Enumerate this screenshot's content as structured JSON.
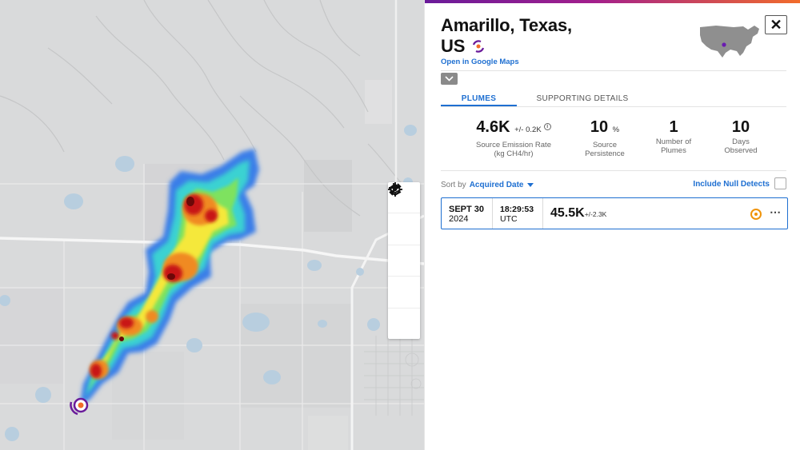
{
  "location": {
    "title_line1": "Amarillo, Texas,",
    "title_line2": "US",
    "maps_link": "Open in Google Maps"
  },
  "tabs": [
    {
      "label": "PLUMES",
      "active": true
    },
    {
      "label": "SUPPORTING DETAILS",
      "active": false
    }
  ],
  "stats": {
    "emission_rate": {
      "value": "4.6K",
      "uncertainty": "+/- 0.2K",
      "label_line1": "Source Emission Rate",
      "label_line2": "(kg CH4/hr)"
    },
    "persistence": {
      "value": "10",
      "unit": "%",
      "label_line1": "Source",
      "label_line2": "Persistence"
    },
    "plumes": {
      "value": "1",
      "label_line1": "Number of",
      "label_line2": "Plumes"
    },
    "days": {
      "value": "10",
      "label_line1": "Days",
      "label_line2": "Observed"
    }
  },
  "sort": {
    "prefix": "Sort by",
    "value": "Acquired Date",
    "null_detects_label": "Include Null Detects",
    "null_detects_checked": false
  },
  "plume_rows": [
    {
      "date": "SEPT 30",
      "year": "2024",
      "time": "18:29:53",
      "timezone": "UTC",
      "rate": "45.5K",
      "uncertainty": "+/-2.3K"
    }
  ],
  "map_controls": [
    "locate-icon",
    "zoom-in-icon",
    "zoom-out-icon",
    "layers-icon",
    "measure-icon"
  ],
  "colors": {
    "accent_blue": "#1e6fd1",
    "brand_gradient_start": "#6a1b9a",
    "brand_gradient_end": "#f26c2a",
    "target_orange": "#f0940a",
    "map_background": "#d9dadb"
  }
}
